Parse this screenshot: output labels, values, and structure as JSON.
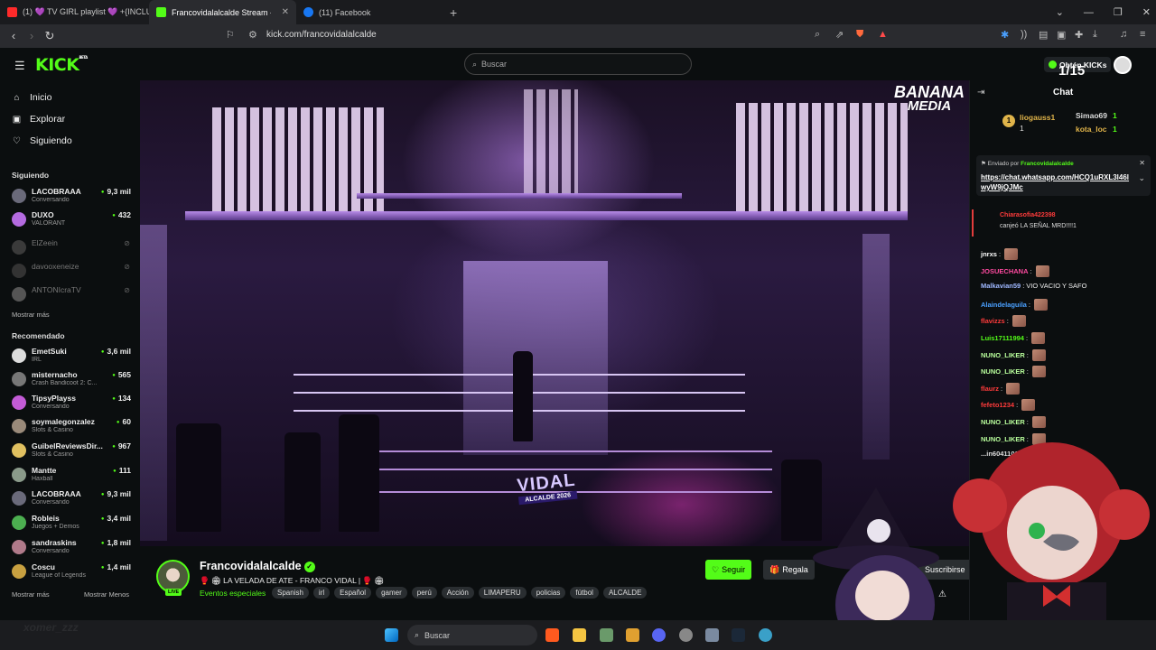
{
  "browser": {
    "tabs": [
      {
        "label": "(1) 💜 TV GIRL playlist 💜 +{INCLUD"
      },
      {
        "label": "Francovidalalcalde Stream - V"
      },
      {
        "label": "(11) Facebook"
      }
    ],
    "url": "kick.com/francovidalalcalde"
  },
  "header": {
    "logo": "KICK",
    "logo_badge": "BETA",
    "search_placeholder": "Buscar",
    "kicks_button": "Obtén KICKs",
    "counter": "1/15"
  },
  "sidebar": {
    "nav": [
      {
        "label": "Inicio"
      },
      {
        "label": "Explorar"
      },
      {
        "label": "Siguiendo"
      }
    ],
    "following_title": "Siguiendo",
    "following": [
      {
        "name": "LACOBRAAA",
        "sub": "Conversando",
        "viewers": "9,3 mil"
      },
      {
        "name": "DUXO",
        "sub": "VALORANT",
        "viewers": "432"
      },
      {
        "name": "ElZeein"
      },
      {
        "name": "davooxeneize"
      },
      {
        "name": "ANTONIcraTV"
      }
    ],
    "show_more": "Mostrar más",
    "recommended_title": "Recomendado",
    "recommended": [
      {
        "name": "EmetSuki",
        "sub": "IRL",
        "viewers": "3,6 mil"
      },
      {
        "name": "misternacho",
        "sub": "Crash Bandicoot 2: C...",
        "viewers": "565"
      },
      {
        "name": "TipsyPlayss",
        "sub": "Conversando",
        "viewers": "134"
      },
      {
        "name": "soymalegonzalez",
        "sub": "Slots & Casino",
        "viewers": "60"
      },
      {
        "name": "GuibelReviewsDir...",
        "sub": "Slots & Casino",
        "viewers": "967"
      },
      {
        "name": "Mantte",
        "sub": "Haxball",
        "viewers": "111"
      },
      {
        "name": "LACOBRAAA",
        "sub": "Conversando",
        "viewers": "9,3 mil"
      },
      {
        "name": "Robleis",
        "sub": "Juegos + Demos",
        "viewers": "3,4 mil"
      },
      {
        "name": "sandraskins",
        "sub": "Conversando",
        "viewers": "1,8 mil"
      },
      {
        "name": "Coscu",
        "sub": "League of Legends",
        "viewers": "1,4 mil"
      }
    ],
    "show_more_2": "Mostrar más",
    "show_less": "Mostrar Menos"
  },
  "video": {
    "watermark_line1": "BANANA",
    "watermark_line2": "MEDIA",
    "banner_line1": "VIDAL",
    "banner_line2": "ALCALDE 2026"
  },
  "stream": {
    "live_badge": "LIVE",
    "channel": "Francovidalalcalde",
    "title": "🥊 🏟 LA VELADA DE ATE - FRANCO VIDAL | 🥊 🏟",
    "category": "Eventos especiales",
    "tags": [
      "Spanish",
      "irl",
      "Español",
      "gamer",
      "perú",
      "Acción",
      "LIMAPERU",
      "policias",
      "fútbol",
      "ALCALDE"
    ],
    "follow": "Seguir",
    "gift": "Regala",
    "subscribe": "Suscribirse"
  },
  "chat": {
    "title": "Chat",
    "top_gifters": [
      {
        "name": "liogauss1",
        "count": "1"
      },
      {
        "name": "Simao69",
        "count": "1"
      },
      {
        "name": "kota_loc",
        "count": "1"
      }
    ],
    "gifter_extra_count": "1",
    "pinned_by_label": "Enviado por",
    "pinned_by_user": "Francovidalalcalde",
    "pinned_link": "https://chat.whatsapp.com/HCQ1uRXL3l46lwyW9jQJMc",
    "redeem_user": "Chiarasofia422398",
    "redeem_text": "canjeó LA SEÑAL MRD!!!!1",
    "messages": [
      {
        "user": "jnrxs",
        "text": "",
        "color": "#ffffff"
      },
      {
        "user": "JOSUECHANA",
        "text": "",
        "color": "#ff4aa0"
      },
      {
        "user": "Malkavian59",
        "text": "VIO VACIO Y SAFO",
        "color": "#9fb8ff"
      },
      {
        "user": "Alaindelaguila",
        "text": "",
        "color": "#4aa0ff"
      },
      {
        "user": "flavizzs",
        "text": "",
        "color": "#ff3b3b"
      },
      {
        "user": "Luis17111994",
        "text": "",
        "color": "#53fc18"
      },
      {
        "user": "NUNO_LIKER",
        "text": "",
        "color": "#b9ff9c"
      },
      {
        "user": "NUNO_LIKER",
        "text": "",
        "color": "#b9ff9c"
      },
      {
        "user": "flaurz",
        "text": "",
        "color": "#ff3b3b"
      },
      {
        "user": "fefeto1234",
        "text": "",
        "color": "#ff3b3b"
      },
      {
        "user": "NUNO_LIKER",
        "text": "",
        "color": "#b9ff9c"
      },
      {
        "user": "NUNO_LIKER",
        "text": "",
        "color": "#b9ff9c"
      },
      {
        "user": "...in60411019",
        "text": "xddd",
        "color": "#dddddd"
      }
    ]
  },
  "taskbar": {
    "search": "Buscar",
    "watermark": "xomer_zzz"
  },
  "colors": {
    "brand": "#53fc18",
    "bg": "#0b0e0f"
  }
}
